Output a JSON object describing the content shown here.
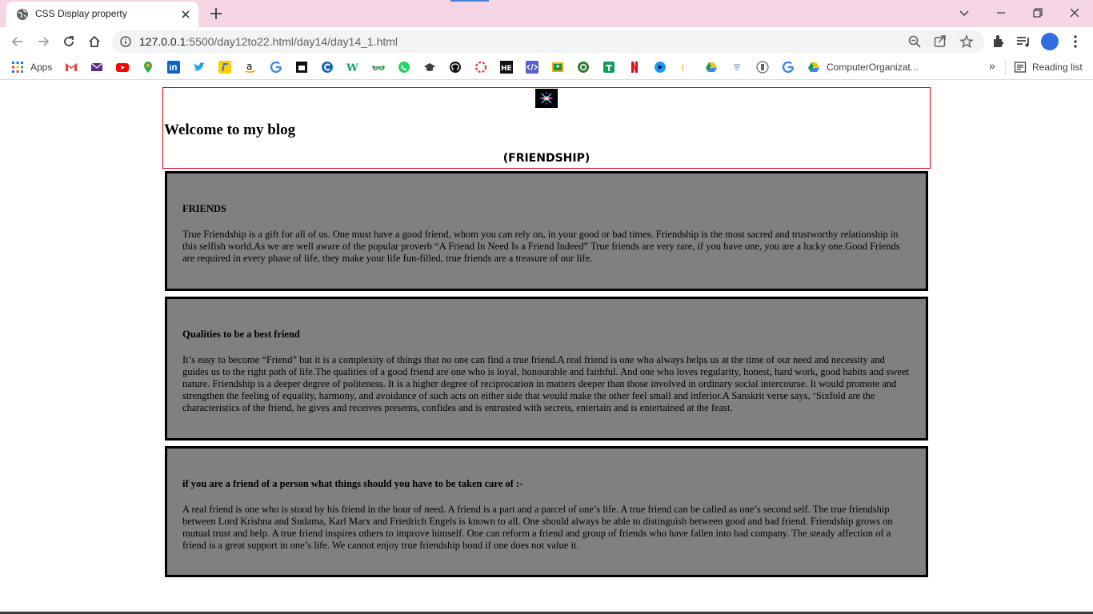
{
  "browser": {
    "tab": {
      "title": "CSS Display property"
    },
    "address_bar": {
      "url_host": "127.0.0.1",
      "url_path": ":5500/day12to22.html/day14/day14_1.html"
    },
    "bookmarks": {
      "apps_label": "Apps",
      "items": [
        "gmail-icon",
        "mail-icon",
        "youtube-icon",
        "maps-icon",
        "linkedin-icon",
        "twitter-icon",
        "flipkart-icon",
        "amazon-icon",
        "google-icon",
        "hackerrank-icon",
        "codechef-icon",
        "w3schools-icon",
        "geeksforgeeks-icon",
        "whatsapp-icon",
        "scholar-icon",
        "github-icon",
        "leetcode-icon",
        "hackerearth-icon",
        "codepen-icon",
        "classroom-icon",
        "meet-icon",
        "sheets-icon",
        "netflix-icon",
        "prime-icon",
        "json-icon",
        "drive-icon",
        "udemy-icon",
        "code-icon",
        "google-icon"
      ],
      "folder_label": "ComputerOrganizat...",
      "overflow_label": "»",
      "reading_list_label": "Reading list"
    }
  },
  "page": {
    "heading": "Welcome to my blog",
    "subtitle": "(FRIENDSHIP)",
    "sections": [
      {
        "title": "FRIENDS",
        "text": "True Friendship is a gift for all of us. One must have a good friend, whom you can rely on, in your good or bad times. Friendship is the most sacred and trustworthy relationship in this selfish world.As we are well aware of the popular proverb “A Friend In Need Is a Friend Indeed” True friends are very rare, if you have one, you are a lucky one.Good Friends are required in every phase of life, they make your life fun-filled, true friends are a treasure of our life."
      },
      {
        "title": "Qualities to be a best friend",
        "text": "It’s easy to become “Friend” but it is a complexity of things that no one can find a true friend.A real friend is one who always helps us at the time of our need and necessity and guides us to the right path of life.The qualities of a good friend are one who is loyal, honourable and faithful. And one who loves regularity, honest, hard work, good habits and sweet nature. Friendship is a deeper degree of politeness. It is a higher degree of reciprocation in matters deeper than those involved in ordinary social intercourse. It would promote and strengthen the feeling of equality, harmony, and avoidance of such acts on either side that would make the other feel small and inferior.A Sanskrit verse says, ‘Sixfold are the characteristics of the friend, he gives and receives presents, confides and is entrusted with secrets, entertain and is entertained at the feast."
      },
      {
        "title": "if you are a friend of a person what things should you have to be taken care of :-",
        "text": "A real friend is one who is stood by his friend in the hour of need. A friend is a part and a parcel of one’s life. A true friend can be called as one’s second self. The true friendship between Lord Krishna and Sudama, Karl Marx and Friedrich Engels is known to all. One should always be able to distinguish between good and bad friend. Friendship grows on mutual trust and help. A true friend inspires others to improve himself. One can reform a friend and group of friends who have fallen into bad company. The steady affection of a friend is a great support in one’s life. We cannot enjoy true friendship bond if one does not value it."
      }
    ]
  },
  "colors": {
    "tabstrip": "#f6d5e5",
    "header_border": "#e0001a",
    "card_bg": "#808080",
    "card_border": "#000000"
  }
}
